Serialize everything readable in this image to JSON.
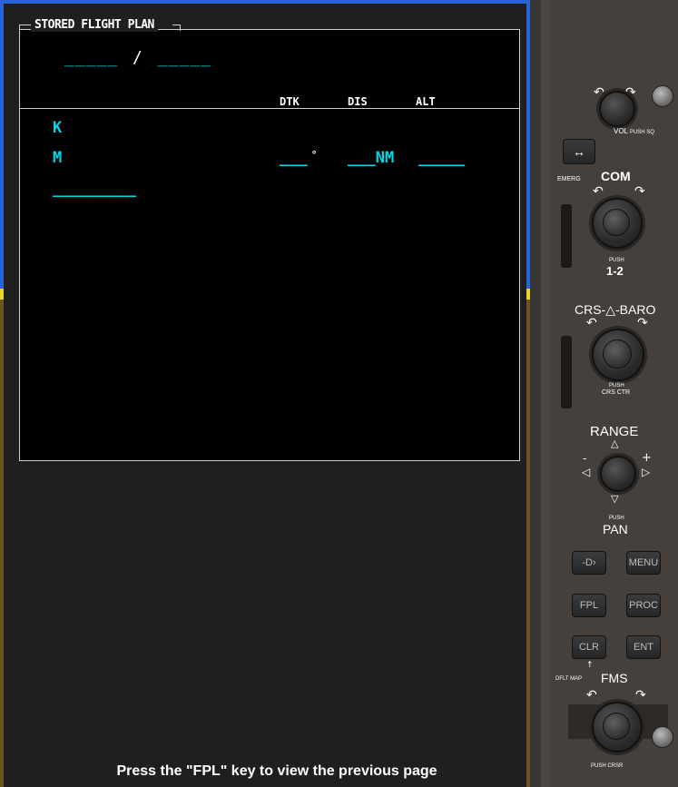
{
  "fpl": {
    "title": "STORED FLIGHT PLAN",
    "route_from": "_____",
    "route_sep": "/",
    "route_to": "_____",
    "headers": {
      "dtk": "DTK",
      "dis": "DIS",
      "alt": "ALT"
    },
    "rows": [
      {
        "ident": "K"
      },
      {
        "ident": "M",
        "dtk": "___",
        "deg": "°",
        "dis": "___NM",
        "alt": "_____"
      },
      {
        "ident": "_________"
      }
    ]
  },
  "footer": {
    "message": "Press the \"FPL\" key to view the previous page"
  },
  "bezel": {
    "vol_label": "VOL",
    "vol_push": "PUSH SQ",
    "emerg_label": "EMERG",
    "com_label": "COM",
    "com_push": "PUSH",
    "com_push2": "1-2",
    "crs_label": "CRS-",
    "baro_label": "-BARO",
    "crs_push": "PUSH",
    "crs_push2": "CRS CTR",
    "range_label": "RANGE",
    "pan_push": "PUSH",
    "pan_label": "PAN",
    "direct_to": "-D›",
    "menu": "MENU",
    "fpl": "FPL",
    "proc": "PROC",
    "clr": "CLR",
    "ent": "ENT",
    "dflt_map": "DFLT MAP",
    "fms_label": "FMS",
    "fms_push": "PUSH CRSR"
  }
}
